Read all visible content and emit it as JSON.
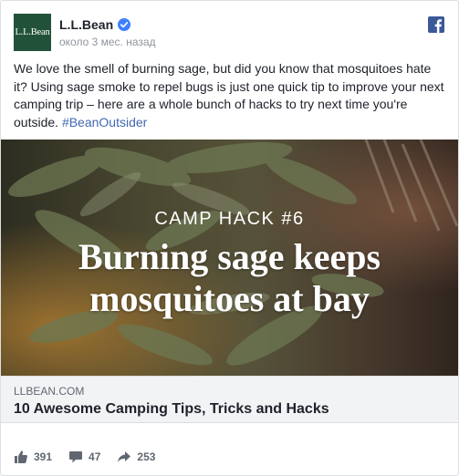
{
  "post": {
    "logo_text": "L.L.Bean",
    "page_name": "L.L.Bean",
    "timestamp": "около 3 мес. назад",
    "text": "We love the smell of burning sage, but did you know that mosquitoes hate it? Using sage smoke to repel bugs is just one quick tip to improve your next camping trip – here are a whole bunch of hacks to try next time you're outside.",
    "hashtag": "#BeanOutsider"
  },
  "hero": {
    "kicker": "CAMP  HACK #6",
    "title_line1": "Burning sage keeps",
    "title_line2": "mosquitoes at bay"
  },
  "link": {
    "domain": "LLBEAN.COM",
    "title": "10 Awesome Camping Tips, Tricks and Hacks"
  },
  "stats": {
    "likes": "391",
    "comments": "47",
    "shares": "253"
  },
  "icons": {
    "verified": "verified-badge-icon",
    "platform": "facebook-icon",
    "like": "thumbs-up-icon",
    "comment": "comment-icon",
    "share": "share-arrow-icon"
  },
  "colors": {
    "brand": "#215239",
    "facebook": "#3b5998",
    "verified": "#4080ff",
    "link": "#4267b2"
  }
}
